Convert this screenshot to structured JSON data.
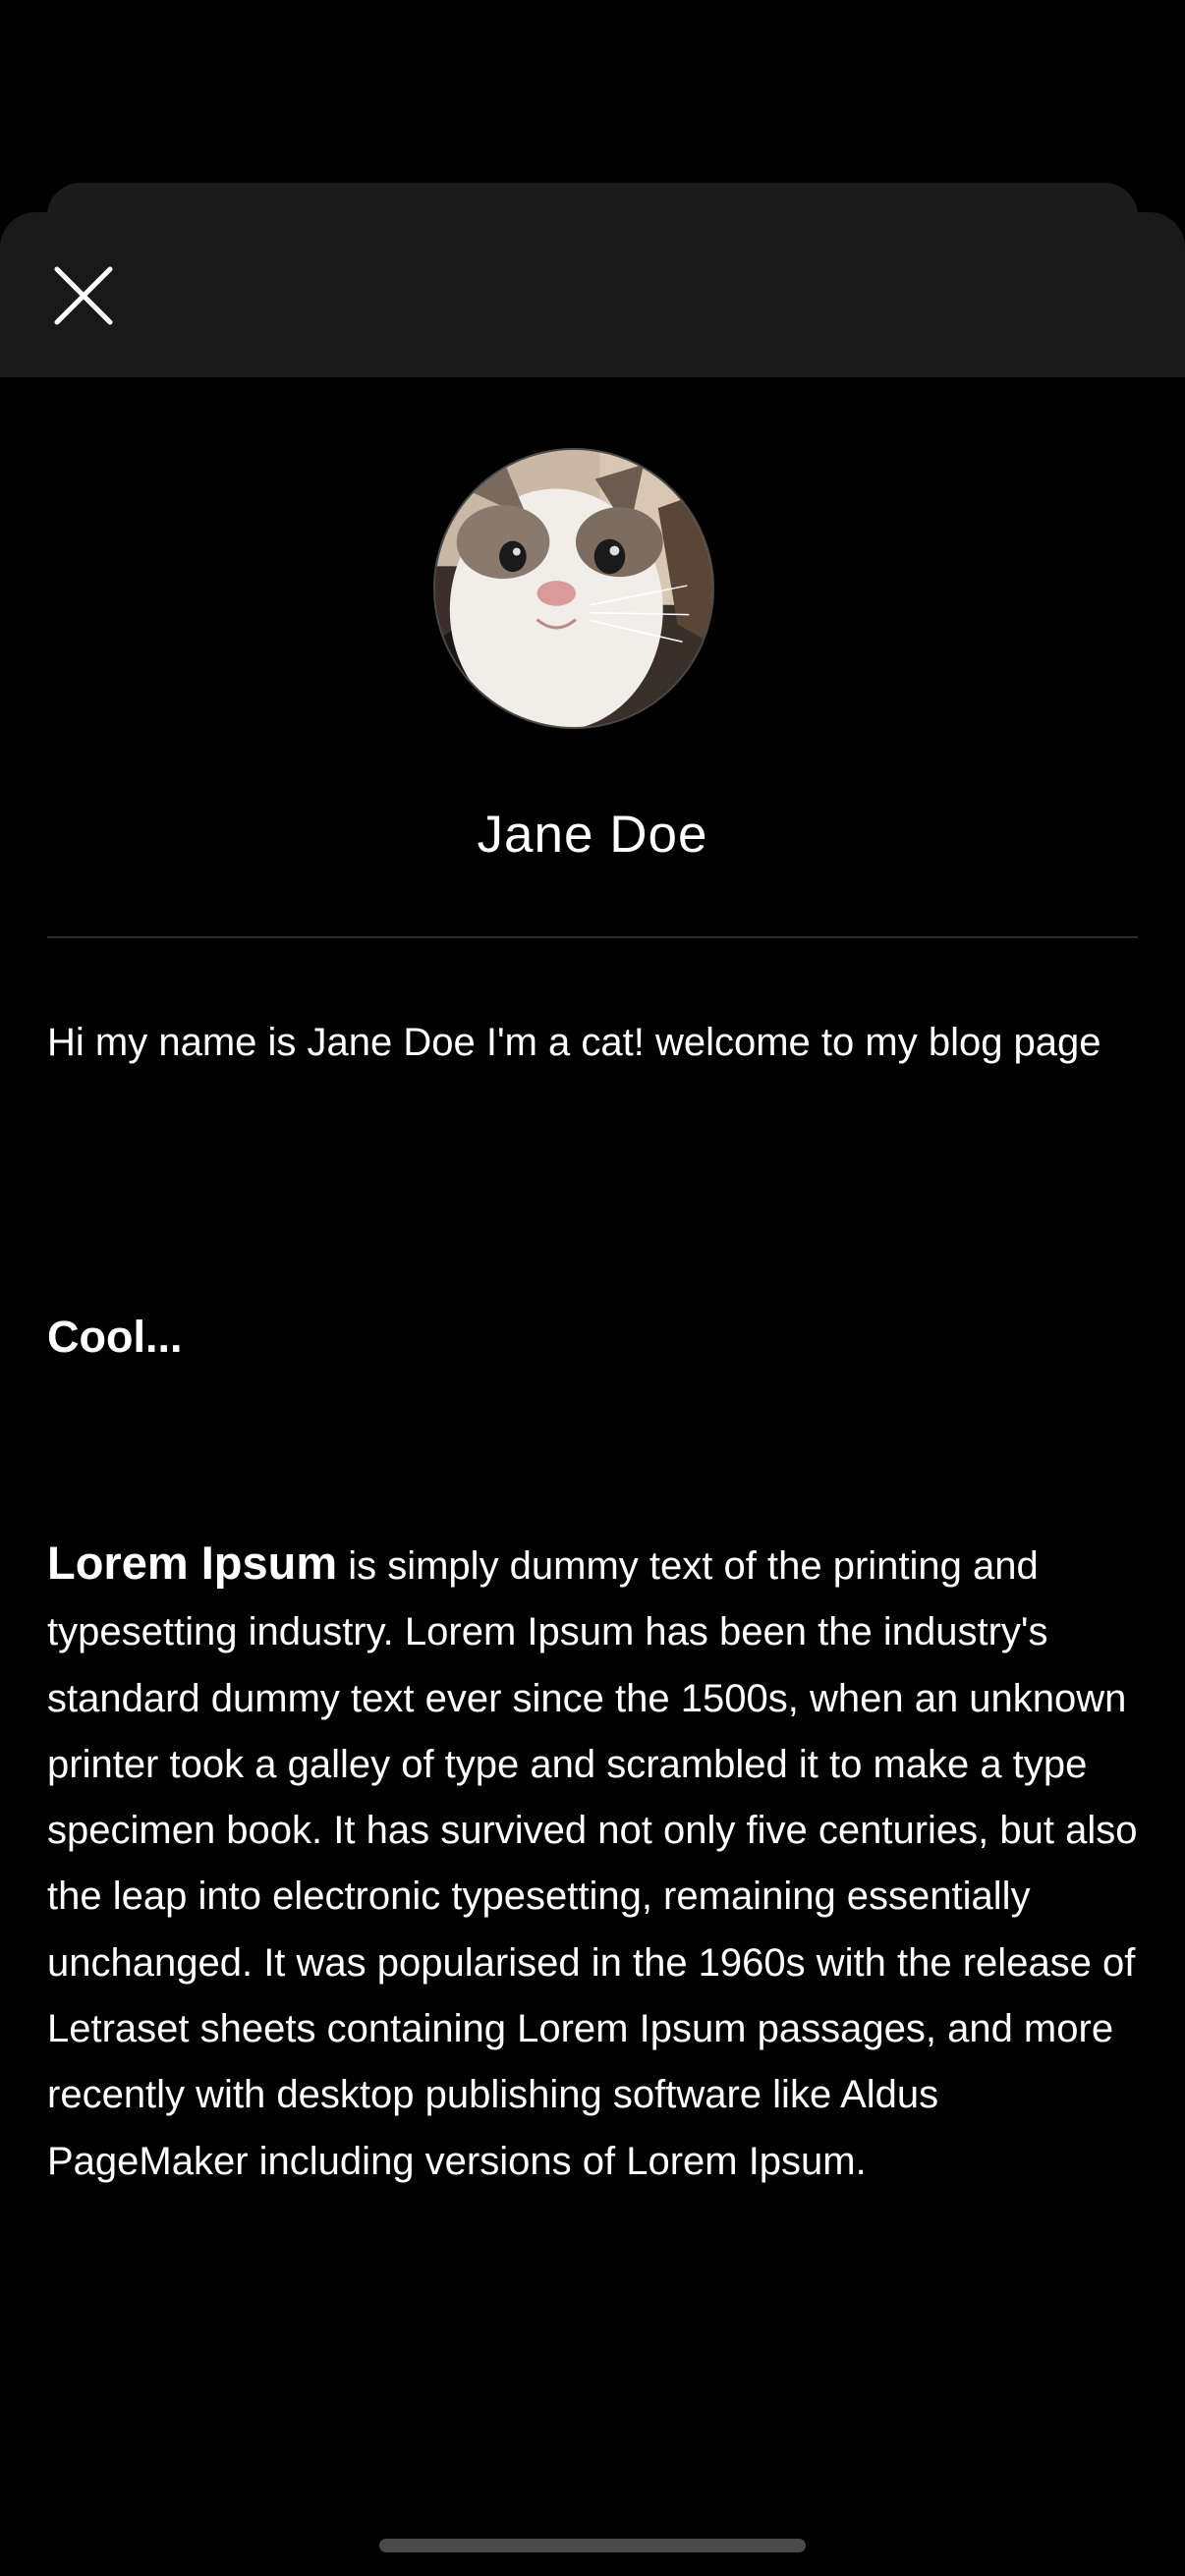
{
  "sheet": {
    "close_icon": "close-icon"
  },
  "profile": {
    "avatar_icon": "cat-avatar",
    "name": "Jane Doe"
  },
  "bio": {
    "text": "Hi my name is Jane Doe I'm a cat! welcome to my blog page"
  },
  "post": {
    "heading": "Cool...",
    "lead": "Lorem Ipsum",
    "body": " is simply dummy text of the printing and typesetting industry. Lorem Ipsum has been the industry's standard dummy text ever since the 1500s, when an unknown printer took a galley of type and scrambled it to make a type specimen book. It has survived not only five centuries, but also the leap into electronic typesetting, remaining essentially unchanged. It was popularised in the 1960s with the release of Letraset sheets containing Lorem Ipsum passages, and more recently with desktop publishing software like Aldus PageMaker including versions of Lorem Ipsum."
  },
  "colors": {
    "background": "#000000",
    "sheet_header": "#191919",
    "text": "#ffffff",
    "divider": "#2c2c2c"
  }
}
